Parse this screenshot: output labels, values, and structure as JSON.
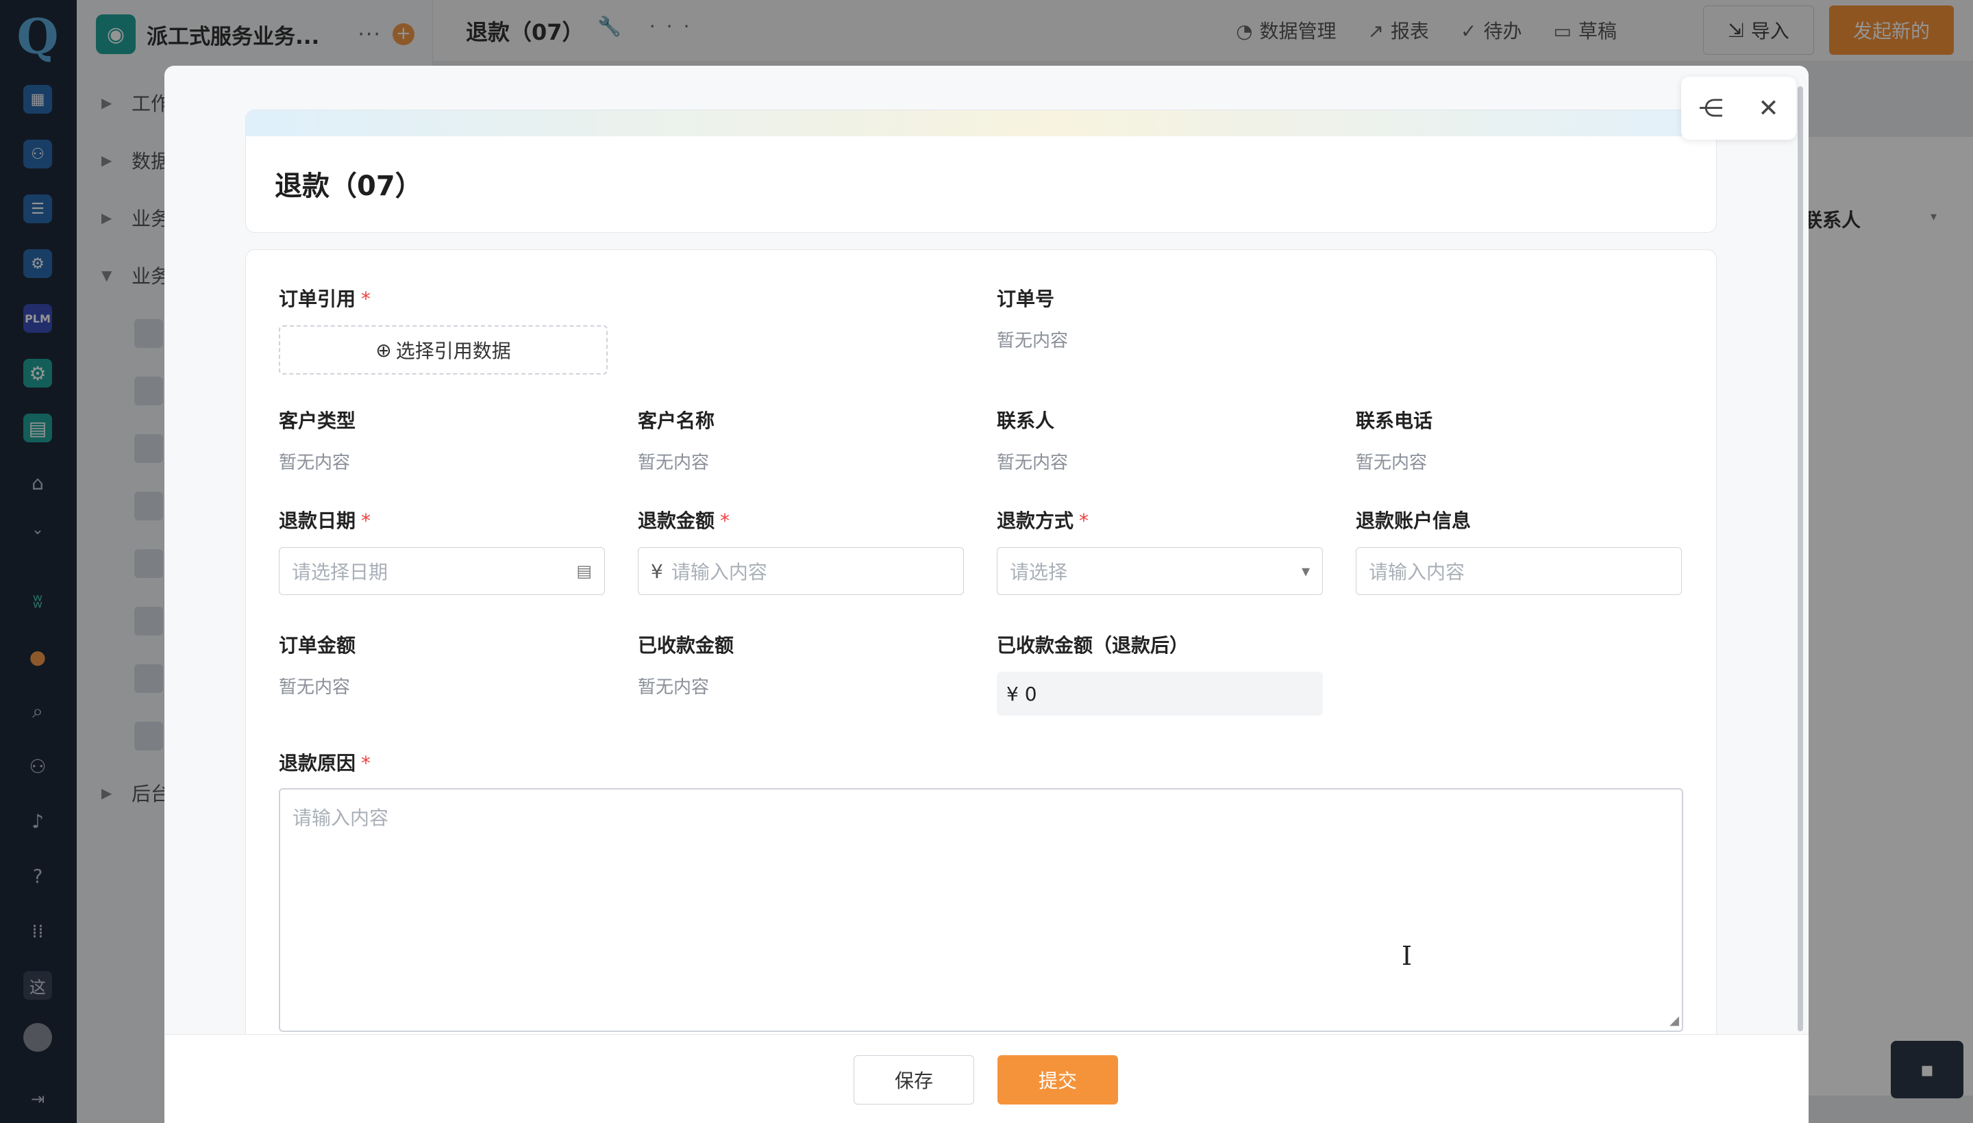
{
  "app": {
    "logo_letter": "Q",
    "title": "派工式服务业务...",
    "more": "···",
    "add": "+"
  },
  "nav_tree": [
    {
      "caret": "▶",
      "label": "工作"
    },
    {
      "caret": "▶",
      "label": "数据"
    },
    {
      "caret": "▶",
      "label": "业务"
    },
    {
      "caret": "▼",
      "label": "业务"
    },
    {
      "caret": "▶",
      "label": "后台"
    }
  ],
  "sidebar": {
    "plm_label": "PLM",
    "zhe_label": "这",
    "collapse_icon": "collapse-icon",
    "icons": [
      "grid-icon",
      "team-icon",
      "database-icon",
      "gear-icon",
      "plm-icon",
      "settings-icon",
      "shop-icon",
      "home-icon",
      "chevron-down-icon",
      "butterfly-icon",
      "add-circle-icon",
      "search-icon",
      "users-icon",
      "bell-icon",
      "help-icon",
      "apps-icon",
      "zhe-icon",
      "avatar-icon"
    ]
  },
  "topbar": {
    "title": "退款（07）",
    "tools": "🔧 ···",
    "menu": [
      {
        "icon": "dashboard-icon",
        "glyph": "◔",
        "label": "数据管理"
      },
      {
        "icon": "report-icon",
        "glyph": "↗",
        "label": "报表"
      },
      {
        "icon": "todo-icon",
        "glyph": "✓",
        "label": "待办"
      },
      {
        "icon": "draft-icon",
        "glyph": "▭",
        "label": "草稿"
      }
    ],
    "import_label": "导入",
    "start_label": "发起新的"
  },
  "background": {
    "column_header": "联系人",
    "column_caret": "▾",
    "chat_glyph": "▪"
  },
  "modal": {
    "share_glyph": "⋲",
    "close_glyph": "✕",
    "form_title": "退款（07）",
    "fields": {
      "order_ref": {
        "label": "订单引用",
        "required": "*",
        "button": "选择引用数据",
        "button_icon": "⊕"
      },
      "order_no": {
        "label": "订单号",
        "value": "暂无内容"
      },
      "customer_type": {
        "label": "客户类型",
        "value": "暂无内容"
      },
      "customer_name": {
        "label": "客户名称",
        "value": "暂无内容"
      },
      "contact": {
        "label": "联系人",
        "value": "暂无内容"
      },
      "phone": {
        "label": "联系电话",
        "value": "暂无内容"
      },
      "refund_date": {
        "label": "退款日期",
        "required": "*",
        "placeholder": "请选择日期",
        "icon_glyph": "▤"
      },
      "refund_amount": {
        "label": "退款金额",
        "required": "*",
        "prefix": "¥",
        "placeholder": "请输入内容"
      },
      "refund_method": {
        "label": "退款方式",
        "required": "*",
        "placeholder": "请选择",
        "caret": "▾"
      },
      "refund_account": {
        "label": "退款账户信息",
        "placeholder": "请输入内容"
      },
      "order_amount": {
        "label": "订单金额",
        "value": "暂无内容"
      },
      "received_amount": {
        "label": "已收款金额",
        "value": "暂无内容"
      },
      "received_after": {
        "label": "已收款金额（退款后）",
        "value": "¥ 0"
      },
      "refund_reason": {
        "label": "退款原因",
        "required": "*",
        "placeholder": "请输入内容",
        "grip": "◢"
      }
    },
    "cursor_glyph": "I",
    "save_label": "保存",
    "submit_label": "提交"
  }
}
